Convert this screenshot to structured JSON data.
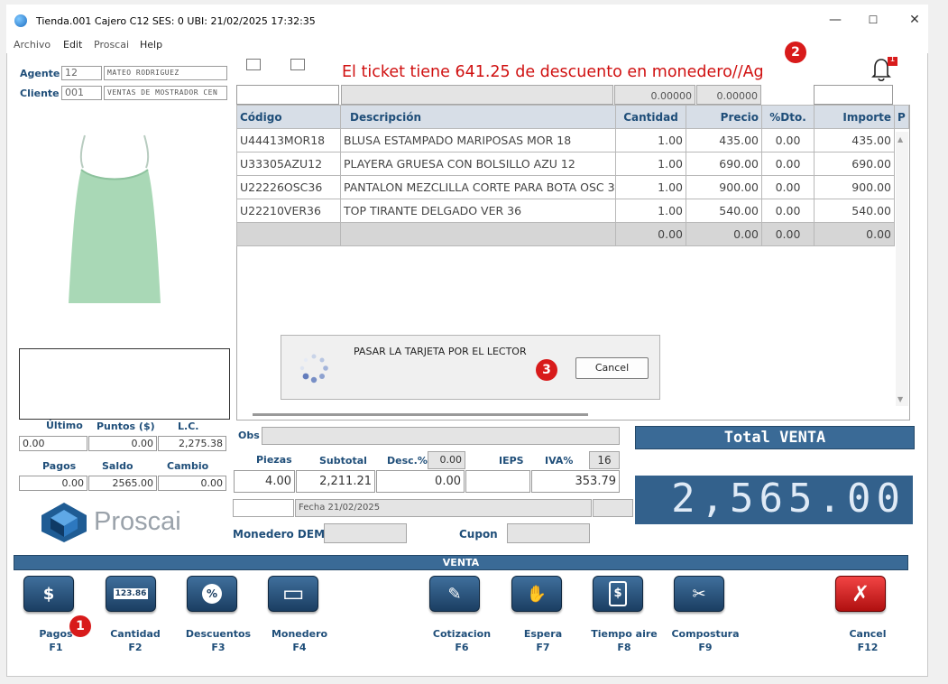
{
  "window": {
    "title": "Tienda.001  Cajero C12     SES: 0   UBI:   21/02/2025 17:32:35",
    "min": "—",
    "max": "☐",
    "close": "✕"
  },
  "menu": [
    "Archivo",
    "Edit",
    "Proscai",
    "Help"
  ],
  "agent": {
    "label": "Agente",
    "code": "12",
    "name": "MATEO RODRIGUEZ"
  },
  "client": {
    "label": "Cliente",
    "code": "001",
    "name": "VENTAS DE MOSTRADOR CEN"
  },
  "message": "El ticket tiene 641.25 de descuento en monedero//Ag",
  "notification_count": "1",
  "top_inputs": {
    "v1": "0.00000",
    "v2": "0.00000"
  },
  "table": {
    "headers": [
      "Código",
      "Descripción",
      "Cantidad",
      "Precio",
      "%Dto.",
      "Importe",
      "P"
    ],
    "rows": [
      [
        "U44413MOR18",
        "BLUSA ESTAMPADO MARIPOSAS MOR 18",
        "1.00",
        "435.00",
        "0.00",
        "435.00"
      ],
      [
        "U33305AZU12",
        "PLAYERA GRUESA CON BOLSILLO AZU 12",
        "1.00",
        "690.00",
        "0.00",
        "690.00"
      ],
      [
        "U22226OSC36",
        "PANTALON MEZCLILLA CORTE  PARA BOTA OSC 36",
        "1.00",
        "900.00",
        "0.00",
        "900.00"
      ],
      [
        "U22210VER36",
        "TOP TIRANTE DELGADO VER 36",
        "1.00",
        "540.00",
        "0.00",
        "540.00"
      ],
      [
        "",
        "",
        "0.00",
        "0.00",
        "0.00",
        "0.00"
      ]
    ]
  },
  "dialog": {
    "text": "PASAR LA TARJETA POR EL LECTOR",
    "cancel": "Cancel"
  },
  "stats": {
    "ultimo_label": "Último",
    "puntos_label": "Puntos ($)",
    "lc_label": "L.C.",
    "ultimo": "0.00",
    "puntos": "0.00",
    "lc": "2,275.38",
    "pagos_label": "Pagos",
    "saldo_label": "Saldo",
    "cambio_label": "Cambio",
    "pagos": "0.00",
    "saldo": "2565.00",
    "cambio": "0.00"
  },
  "logo": "Proscai",
  "obs_label": "Obs",
  "summary": {
    "piezas_label": "Piezas",
    "subtotal_label": "Subtotal",
    "desc_label": "Desc.%",
    "desc_pct": "0.00",
    "ieps_label": "IEPS",
    "iva_label": "IVA%",
    "iva_pct": "16",
    "piezas": "4.00",
    "subtotal": "2,211.21",
    "desc": "0.00",
    "ieps": "",
    "iva": "353.79"
  },
  "fecha": "Fecha 21/02/2025",
  "monedero_label": "Monedero DEM",
  "cupon_label": "Cupon",
  "total": {
    "label": "Total VENTA",
    "value": "2,565.00"
  },
  "section": "VENTA",
  "fkeys": [
    {
      "label": "Pagos",
      "key": "F1",
      "icon": "$"
    },
    {
      "label": "Cantidad",
      "key": "F2",
      "icon": "123.86"
    },
    {
      "label": "Descuentos",
      "key": "F3",
      "icon": "%"
    },
    {
      "label": "Monedero",
      "key": "F4",
      "icon": "▭"
    },
    {
      "label": "Cotizacion",
      "key": "F6",
      "icon": "✎"
    },
    {
      "label": "Espera",
      "key": "F7",
      "icon": "✋"
    },
    {
      "label": "Tiempo aire",
      "key": "F8",
      "icon": "$"
    },
    {
      "label": "Compostura",
      "key": "F9",
      "icon": "✂"
    },
    {
      "label": "Cancel",
      "key": "F12",
      "icon": "✗"
    }
  ],
  "markers": [
    "1",
    "2",
    "3"
  ],
  "colors": {
    "accent": "#1f4e79",
    "message": "#d01010",
    "total_bg": "#33618c",
    "cancel_btn": "#d42020"
  }
}
